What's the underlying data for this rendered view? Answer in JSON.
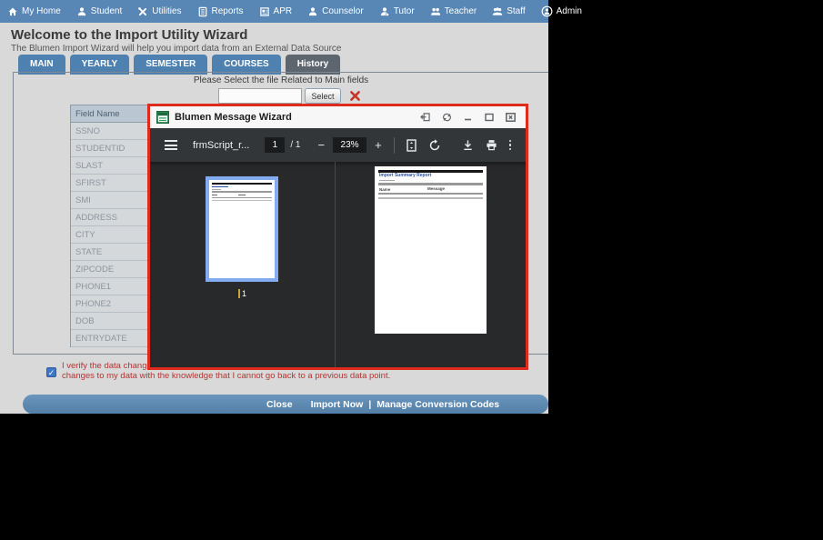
{
  "nav": {
    "items": [
      {
        "label": "My Home",
        "icon": "home-icon"
      },
      {
        "label": "Student",
        "icon": "student-icon"
      },
      {
        "label": "Utilities",
        "icon": "utilities-icon"
      },
      {
        "label": "Reports",
        "icon": "reports-icon"
      },
      {
        "label": "APR",
        "icon": "apr-icon"
      },
      {
        "label": "Counselor",
        "icon": "counselor-icon"
      },
      {
        "label": "Tutor",
        "icon": "tutor-icon"
      },
      {
        "label": "Teacher",
        "icon": "teacher-icon"
      },
      {
        "label": "Staff",
        "icon": "staff-icon"
      },
      {
        "label": "Admin",
        "icon": "admin-icon"
      }
    ]
  },
  "header": {
    "title": "Welcome to the Import Utility Wizard",
    "subtitle": "The Blumen Import Wizard will help you import data from an External Data Source"
  },
  "tabs": [
    {
      "label": "MAIN"
    },
    {
      "label": "YEARLY"
    },
    {
      "label": "SEMESTER"
    },
    {
      "label": "COURSES"
    },
    {
      "label": "History",
      "active": true
    }
  ],
  "file_select": {
    "prompt": "Please Select the file Related to Main fields",
    "input_value": "",
    "select_label": "Select"
  },
  "field_table": {
    "header": "Field Name",
    "rows": [
      "SSNO",
      "STUDENTID",
      "SLAST",
      "SFIRST",
      "SMI",
      "ADDRESS",
      "CITY",
      "STATE",
      "ZIPCODE",
      "PHONE1",
      "PHONE2",
      "DOB",
      "ENTRYDATE"
    ]
  },
  "verify": {
    "checked": true,
    "check_glyph": "✓",
    "line1": "I verify the data changes to",
    "line2": "changes to my data with the knowledge that I cannot go back to a previous data point."
  },
  "bottom_bar": {
    "close": "Close",
    "import": "Import Now",
    "separator": "|",
    "manage": "Manage Conversion Codes"
  },
  "modal": {
    "title": "Blumen Message Wizard",
    "pdf_toolbar": {
      "filename": "frmScript_r...",
      "page_current": "1",
      "page_separator": "/",
      "page_total": "1",
      "zoom_out": "−",
      "zoom_level": "23%",
      "zoom_in": "+"
    },
    "thumbnail": {
      "page_label": "1"
    },
    "report_page": {
      "title": "Import Summary Report",
      "col_name": "Name",
      "col_message": "Message"
    }
  },
  "colors": {
    "nav_blue": "#5886b5",
    "tab_blue": "#4e81b0",
    "tab_active_gray": "#5d666e",
    "modal_border_red": "#df2b1e",
    "pdf_toolbar_dark": "#323639",
    "thumb_selection_blue": "#82abf0",
    "verify_text_red": "#b23535",
    "bottom_bar_blue": "#537fa8",
    "checkbox_blue": "#3f76c8"
  }
}
